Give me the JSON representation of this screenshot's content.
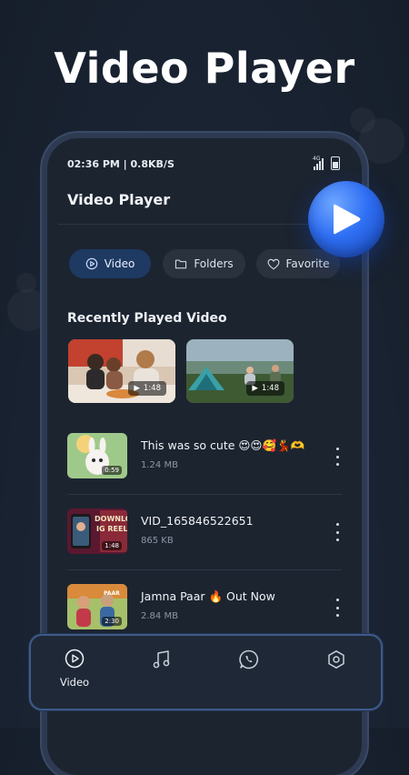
{
  "headline": "Video Player",
  "status": {
    "time_speed": "02:36 PM | 0.8KB/S",
    "network": "4G"
  },
  "app": {
    "title": "Video Player"
  },
  "tabs": [
    {
      "label": "Video",
      "icon": "play-circle-icon",
      "active": true
    },
    {
      "label": "Folders",
      "icon": "folder-icon",
      "active": false
    },
    {
      "label": "Favorite",
      "icon": "heart-icon",
      "active": false
    }
  ],
  "recent": {
    "title": "Recently Played Video",
    "items": [
      {
        "duration": "1:48"
      },
      {
        "duration": "1:48"
      }
    ]
  },
  "videos": [
    {
      "title": "This was so cute 😍😍🥰💃🫶",
      "size": "1.24 MB",
      "duration": "0:59"
    },
    {
      "title": "VID_165846522651",
      "size": "865 KB",
      "duration": "1:48"
    },
    {
      "title": "Jamna Paar 🔥 Out Now",
      "size": "2.84 MB",
      "duration": "2:30"
    }
  ],
  "bottom_nav": [
    {
      "label": "Video",
      "icon": "play-circle-icon",
      "active": true
    },
    {
      "label": "",
      "icon": "music-icon",
      "active": false
    },
    {
      "label": "",
      "icon": "whatsapp-icon",
      "active": false
    },
    {
      "label": "",
      "icon": "settings-icon",
      "active": false
    }
  ],
  "colors": {
    "accent": "#2f6ff3",
    "active_tab_bg": "#1e3a63",
    "background": "#1b2534"
  }
}
